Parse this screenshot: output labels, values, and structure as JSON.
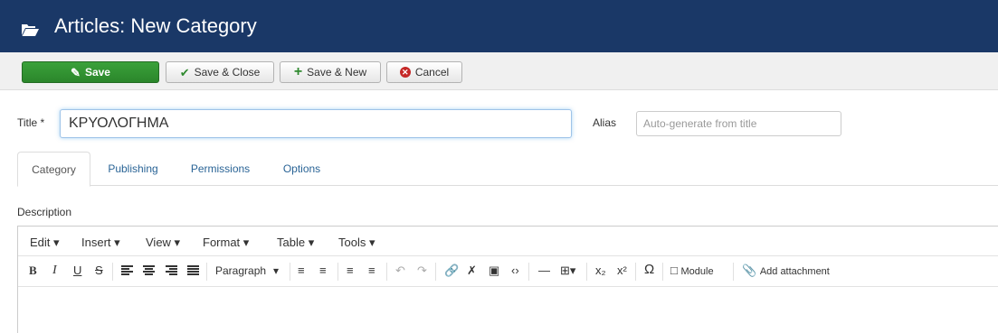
{
  "header": {
    "icon": "folder-open-icon",
    "title": "Articles: New Category"
  },
  "toolbar": {
    "save": "Save",
    "save_close": "Save & Close",
    "save_new": "Save & New",
    "cancel": "Cancel",
    "colors": {
      "save": "#2f922f",
      "header_bg": "#1a3867"
    }
  },
  "form": {
    "title_label": "Title *",
    "title_value": "ΚΡΥΟΛΟΓΗΜΑ",
    "alias_label": "Alias",
    "alias_placeholder": "Auto-generate from title"
  },
  "tabs": {
    "category": "Category",
    "publishing": "Publishing",
    "permissions": "Permissions",
    "options": "Options"
  },
  "description_label": "Description",
  "editor": {
    "menus": {
      "edit": "Edit ▾",
      "insert": "Insert ▾",
      "view": "View ▾",
      "format": "Format ▾",
      "table": "Table ▾",
      "tools": "Tools ▾"
    },
    "toolbar": {
      "bold": "B",
      "italic": "I",
      "underline": "U",
      "strike": "S",
      "paragraph": "Paragraph",
      "module": "Module",
      "add_attachment": "Add attachment"
    }
  }
}
